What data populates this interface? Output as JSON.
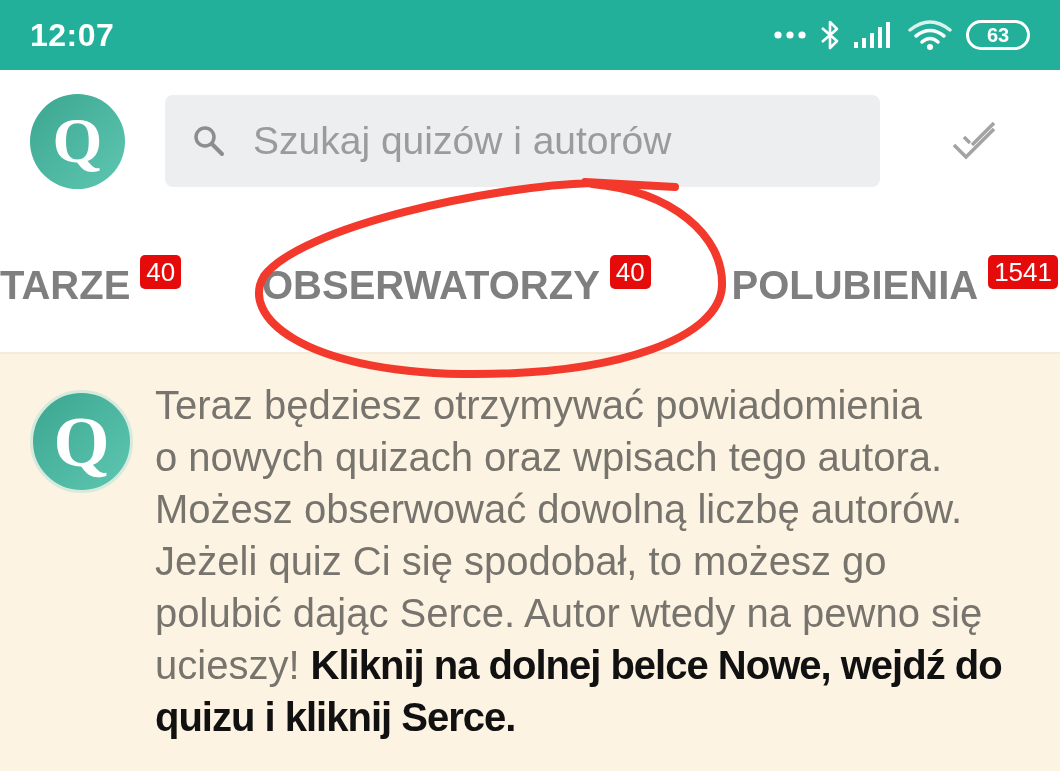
{
  "status_bar": {
    "time": "12:07",
    "battery": "63"
  },
  "header": {
    "logo": "Q",
    "search": {
      "placeholder": "Szukaj quizów i autorów"
    }
  },
  "tabs": [
    {
      "label": "TARZE",
      "badge": "40",
      "selected": false,
      "circled": false
    },
    {
      "label": "OBSERWATORZY",
      "badge": "40",
      "selected": false,
      "circled": true
    },
    {
      "label": "POLUBIENIA",
      "badge": "1541",
      "selected": false,
      "circled": false
    }
  ],
  "notice": {
    "avatar": "Q",
    "text": "Teraz będziesz otrzymywać powiadomienia o nowych quizach oraz wpisach tego autora. Możesz obserwować dowolną liczbę autorów. Jeżeli quiz Ci się spodobał, to możesz go polubić dając Serce. Autor wtedy na pewno się ucieszy! **Kliknij na dolnej belce Nowe, wejdź do quizu i kliknij Serce.**"
  }
}
